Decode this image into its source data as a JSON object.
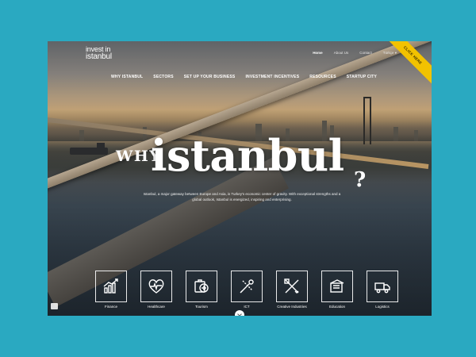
{
  "brand": {
    "line1": "invest in",
    "line2": "istanbul"
  },
  "ribbon": {
    "label": "CLICK HERE"
  },
  "top_nav": [
    {
      "label": "Home",
      "active": true
    },
    {
      "label": "About Us",
      "active": false
    },
    {
      "label": "Contact",
      "active": false
    },
    {
      "label": "Türkçe ▾",
      "active": false
    }
  ],
  "main_nav": [
    {
      "label": "WHY ISTANBUL"
    },
    {
      "label": "SECTORS"
    },
    {
      "label": "SET UP YOUR BUSINESS"
    },
    {
      "label": "INVESTMENT INCENTIVES"
    },
    {
      "label": "RESOURCES"
    },
    {
      "label": "STARTUP CITY"
    }
  ],
  "hero": {
    "why": "WHY",
    "city": "istanbul",
    "qmark": "?",
    "tagline": "Istanbul, a major gateway between Europe and Asia, is Turkey's economic center of gravity. With exceptional strengths and a global outlook, Istanbul is energized, inspiring and enterprising."
  },
  "sectors": [
    {
      "label": "Finance",
      "icon": "finance-chart-icon"
    },
    {
      "label": "Healthcare",
      "icon": "heart-pulse-icon"
    },
    {
      "label": "Tourism",
      "icon": "tourism-icon"
    },
    {
      "label": "ICT",
      "icon": "ict-tools-icon"
    },
    {
      "label": "Creative Industries",
      "icon": "creative-tools-icon"
    },
    {
      "label": "Education",
      "icon": "education-icon"
    },
    {
      "label": "Logistics",
      "icon": "logistics-truck-icon"
    }
  ],
  "colors": {
    "frame": "#2aa9c1",
    "ribbon": "#f2c200",
    "text": "#ffffff"
  }
}
